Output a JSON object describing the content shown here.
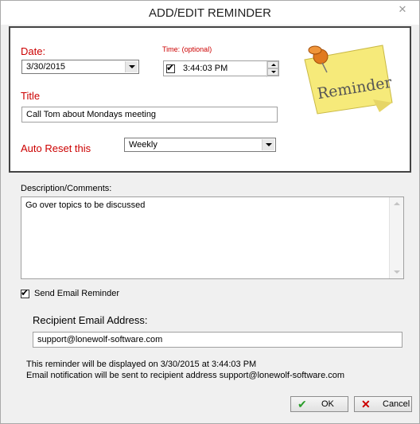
{
  "window": {
    "title": "ADD/EDIT REMINDER",
    "close_glyph": "✕"
  },
  "panel": {
    "date_label": "Date:",
    "date_value": "3/30/2015",
    "time_label": "Time: (optional)",
    "time_value": "3:44:03 PM",
    "time_checked": true,
    "title_label": "Title",
    "title_value": "Call Tom about Mondays meeting",
    "auto_reset_label": "Auto Reset this",
    "auto_reset_value": "Weekly",
    "sticky_note_text": "Reminder"
  },
  "description": {
    "label": "Description/Comments:",
    "value": "Go over topics to be discussed"
  },
  "email": {
    "send_label": "Send Email Reminder",
    "send_checked": true,
    "recipient_label": "Recipient Email Address:",
    "recipient_value": "support@lonewolf-software.com"
  },
  "summary": {
    "line1": "This reminder will be displayed on 3/30/2015 at 3:44:03 PM",
    "line2": "Email notification will be sent to recipient address support@lonewolf-software.com"
  },
  "buttons": {
    "ok_label": "OK",
    "cancel_label": "Cancel"
  },
  "icons": {
    "check": "✔",
    "ok_icon": "check-icon",
    "cancel_icon": "x-icon",
    "cancel_glyph": "✕"
  },
  "colors": {
    "label_red": "#cc0000",
    "ok_green": "#2a9d2a",
    "cancel_red": "#cc0000",
    "note_yellow": "#f6ea7a",
    "pin_orange": "#e07a1f"
  }
}
